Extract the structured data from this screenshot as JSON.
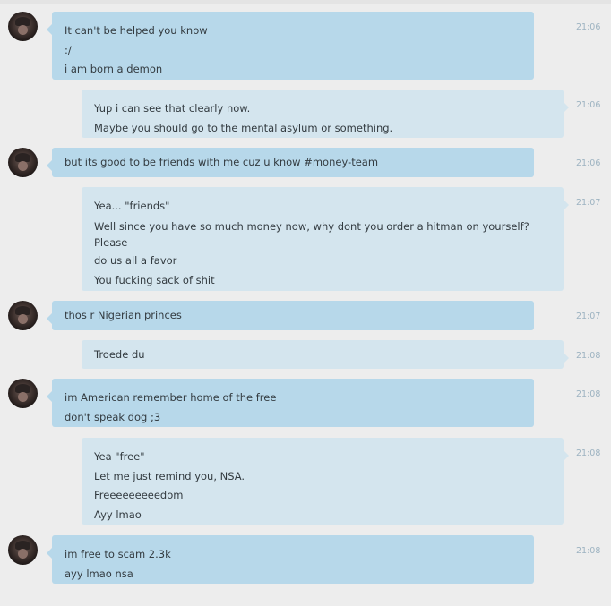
{
  "messages": [
    {
      "sender": "them",
      "time": "21:06",
      "lines": [
        "It can't be helped you know",
        ":/",
        "i am born a demon"
      ]
    },
    {
      "sender": "me",
      "time": "21:06",
      "lines": [
        "Yup i can see that clearly now.",
        "Maybe you should go to the mental asylum or something."
      ]
    },
    {
      "sender": "them",
      "time": "21:06",
      "lines": [
        "but its good to be friends with me cuz u know #money-team"
      ]
    },
    {
      "sender": "me",
      "time": "21:07",
      "lines": [
        "Yea... \"friends\"",
        "Well since you have so much money now, why dont you order a hitman on yourself? Please",
        "do us all a favor",
        "You fucking sack of shit"
      ]
    },
    {
      "sender": "them",
      "time": "21:07",
      "lines": [
        "thos r Nigerian princes"
      ]
    },
    {
      "sender": "me",
      "time": "21:08",
      "lines": [
        "Troede du"
      ]
    },
    {
      "sender": "them",
      "time": "21:08",
      "lines": [
        "im American remember home of the free",
        "don't speak dog ;3"
      ]
    },
    {
      "sender": "me",
      "time": "21:08",
      "lines": [
        "Yea \"free\"",
        "Let me just remind you, NSA.",
        "Freeeeeeeeedom",
        "Ayy lmao"
      ]
    },
    {
      "sender": "them",
      "time": "21:08",
      "lines": [
        "im free to scam 2.3k",
        "ayy lmao nsa"
      ]
    }
  ]
}
